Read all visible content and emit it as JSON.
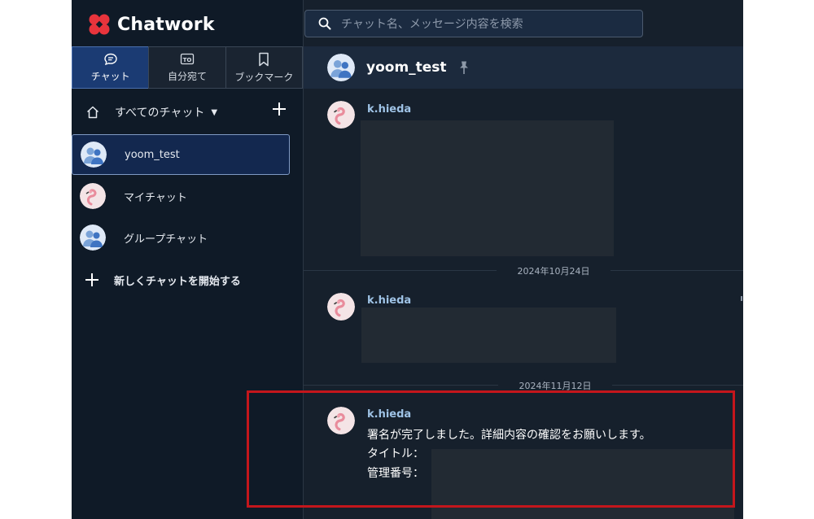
{
  "app": {
    "name": "Chatwork",
    "brand_color": "#e8343c"
  },
  "search": {
    "placeholder": "チャット名、メッセージ内容を検索",
    "icon": "search-icon"
  },
  "tabs": [
    {
      "label": "チャット",
      "icon": "chat-bubble-icon",
      "active": true
    },
    {
      "label": "自分宛て",
      "icon": "to-icon",
      "icon_text": "TO",
      "active": false
    },
    {
      "label": "ブックマーク",
      "icon": "bookmark-icon",
      "active": false
    }
  ],
  "filter": {
    "label": "すべてのチャット",
    "icon": "home-icon"
  },
  "rooms": [
    {
      "name": "yoom_test",
      "avatar": "group-avatar",
      "selected": true
    },
    {
      "name": "マイチャット",
      "avatar": "flamingo-avatar",
      "selected": false
    },
    {
      "name": "グループチャット",
      "avatar": "group-avatar",
      "selected": false
    }
  ],
  "new_chat": {
    "label": "新しくチャットを開始する"
  },
  "room_header": {
    "title": "yoom_test",
    "icon": "pin-icon"
  },
  "messages": [
    {
      "sender": "k.hieda",
      "redacted": true
    },
    {
      "date": "2024年10月24日",
      "sender": "k.hieda",
      "redacted": true
    },
    {
      "date": "2024年11月12日",
      "sender": "k.hieda",
      "lines": [
        "署名が完了しました。詳細内容の確認をお願いします。",
        "タイトル：",
        "管理番号："
      ],
      "highlight_color": "#c4161c"
    }
  ]
}
